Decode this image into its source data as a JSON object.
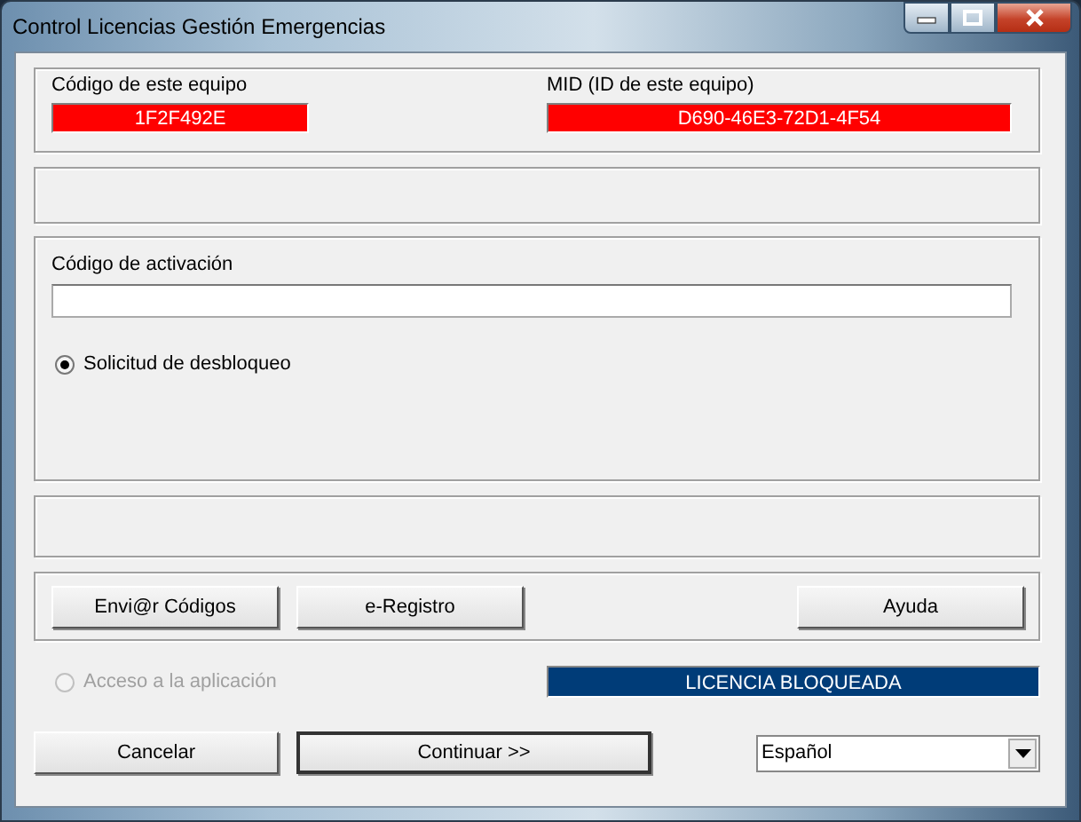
{
  "window": {
    "title": "Control Licencias Gestión Emergencias"
  },
  "machine_code": {
    "label": "Código de este equipo",
    "value": "1F2F492E"
  },
  "mid": {
    "label": "MID (ID de este equipo)",
    "value": "D690-46E3-72D1-4F54"
  },
  "activation_code": {
    "label": "Código de activación"
  },
  "options": [
    {
      "label": "Solicitud de desbloqueo",
      "selected": true,
      "disabled": false
    },
    {
      "label": "Acceso a la aplicación",
      "selected": false,
      "disabled": true
    }
  ],
  "action_buttons": [
    "Envi@r Códigos",
    "e-Registro",
    "Ayuda"
  ],
  "license_status": "LICENCIA BLOQUEADA",
  "footer_buttons": [
    "Cancelar",
    "Continuar >>"
  ],
  "language": {
    "value": "Español"
  }
}
